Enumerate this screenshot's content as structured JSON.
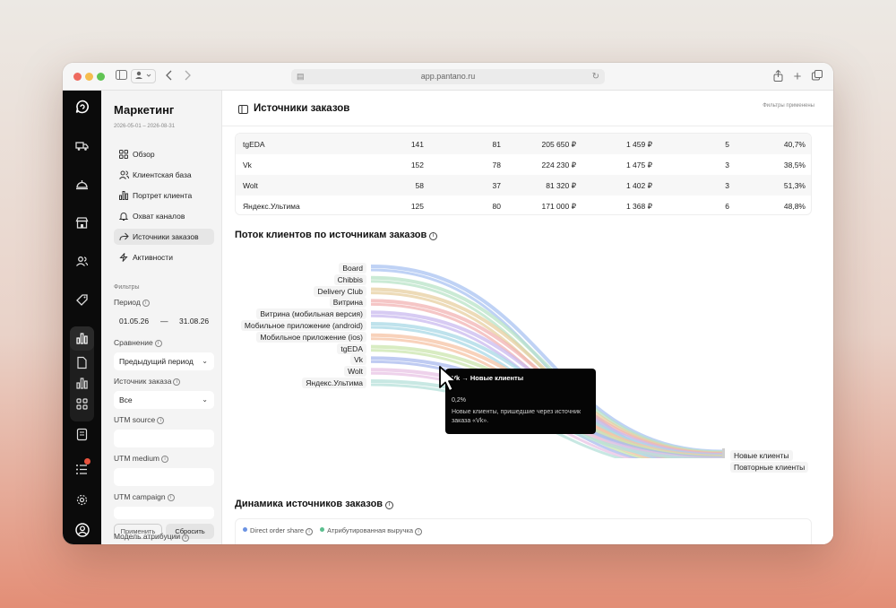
{
  "browser": {
    "url": "app.pantano.ru"
  },
  "sidebar": {
    "title": "Маркетинг",
    "date_range": "2026-05-01 – 2026-08-31",
    "nav": [
      {
        "label": "Обзор",
        "icon": "grid-icon",
        "active": false
      },
      {
        "label": "Клиентская база",
        "icon": "users-icon",
        "active": false
      },
      {
        "label": "Портрет клиента",
        "icon": "bar-chart-icon",
        "active": false
      },
      {
        "label": "Охват каналов",
        "icon": "bell-icon",
        "active": false
      },
      {
        "label": "Источники заказов",
        "icon": "share-icon",
        "active": true
      },
      {
        "label": "Активности",
        "icon": "bolt-icon",
        "active": false
      }
    ],
    "filters_label": "Фильтры",
    "period_label": "Период",
    "period_from": "01.05.26",
    "period_sep": "—",
    "period_to": "31.08.26",
    "compare_label": "Сравнение",
    "compare_value": "Предыдущий период",
    "source_label": "Источник заказа",
    "source_value": "Все",
    "utm_source_label": "UTM source",
    "utm_medium_label": "UTM medium",
    "utm_campaign_label": "UTM campaign",
    "attribution_label": "Модель атрибуции",
    "apply_label": "Применить",
    "reset_label": "Сбросить"
  },
  "header": {
    "title": "Источники заказов",
    "filters_status": "Фильтры применены"
  },
  "table": {
    "rows": [
      {
        "source": "tgEDA",
        "c1": "141",
        "c2": "81",
        "revenue": "205 650 ₽",
        "avg": "1 459 ₽",
        "c5": "5",
        "share": "40,7%"
      },
      {
        "source": "Vk",
        "c1": "152",
        "c2": "78",
        "revenue": "224 230 ₽",
        "avg": "1 475 ₽",
        "c5": "3",
        "share": "38,5%"
      },
      {
        "source": "Wolt",
        "c1": "58",
        "c2": "37",
        "revenue": "81 320 ₽",
        "avg": "1 402 ₽",
        "c5": "3",
        "share": "51,3%"
      },
      {
        "source": "Яндекс.Ультима",
        "c1": "125",
        "c2": "80",
        "revenue": "171 000 ₽",
        "avg": "1 368 ₽",
        "c5": "6",
        "share": "48,8%"
      }
    ]
  },
  "sankey": {
    "title": "Поток клиентов по источникам заказов",
    "sources": [
      "Board",
      "Chibbis",
      "Delivery Club",
      "Витрина",
      "Витрина (мобильная версия)",
      "Мобильное приложение (android)",
      "Мобильное приложение (ios)",
      "tgEDA",
      "Vk",
      "Wolt",
      "Яндекс.Ультима"
    ],
    "targets": [
      "Новые клиенты",
      "Повторные клиенты"
    ],
    "colors": [
      "#a9c3f2",
      "#b8e3c7",
      "#e7cfa0",
      "#f2b3b3",
      "#c9b9ef",
      "#a8d8e6",
      "#f5c3a4",
      "#cbe6ad",
      "#a9b9ee",
      "#e8c3e4",
      "#b6e0da"
    ],
    "tooltip": {
      "title": "Vk → Новые клиенты",
      "value": "0,2%",
      "description": "Новые клиенты, пришедшие через источник заказа «Vk»."
    }
  },
  "dynamics": {
    "title": "Динамика источников заказов",
    "legend": [
      {
        "name": "Direct order share",
        "color": "#6b93e3"
      },
      {
        "name": "Атрибутированная выручка",
        "color": "#5bbf8f"
      }
    ]
  }
}
